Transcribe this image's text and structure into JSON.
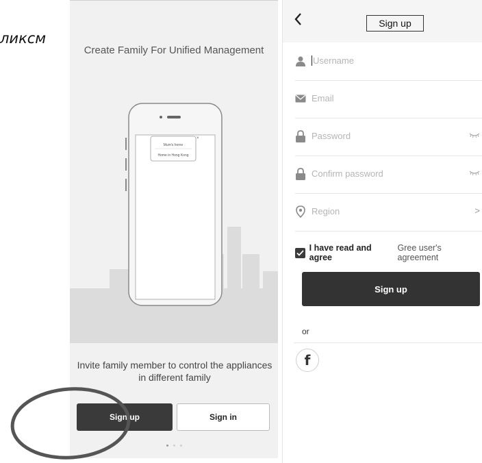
{
  "caption": "ликсм",
  "left": {
    "title": "Create Family For Unified Management",
    "phone_card": {
      "line1": "Mum's home",
      "line2": "Home in Hong Kong"
    },
    "invite_text_line1": "Invite family member to control the appliances",
    "invite_text_line2": "in different family",
    "signup_button": "Sign up",
    "signin_button": "Sign in",
    "page_dots": {
      "count": 3,
      "active": 1
    }
  },
  "right": {
    "header_title": "Sign up",
    "back_icon": "chevron-left-icon",
    "fields": {
      "username": {
        "placeholder": "Username",
        "icon": "user-icon"
      },
      "email": {
        "placeholder": "Email",
        "icon": "mail-icon"
      },
      "password": {
        "placeholder": "Password",
        "icon": "lock-icon",
        "trailing_icon": "eye-closed-icon"
      },
      "confirm": {
        "placeholder": "Confirm password",
        "icon": "lock-icon",
        "trailing_icon": "eye-closed-icon"
      },
      "region": {
        "placeholder": "Region",
        "icon": "location-pin-icon",
        "trailing": ">"
      }
    },
    "agree_checked": true,
    "agree_text": "I have read and agree",
    "agree_link": "Gree user's agreement",
    "signup_button": "Sign up",
    "or_text": "or",
    "facebook_icon": "f"
  },
  "colors": {
    "button_dark": "#333333",
    "annotation": "#555555"
  }
}
